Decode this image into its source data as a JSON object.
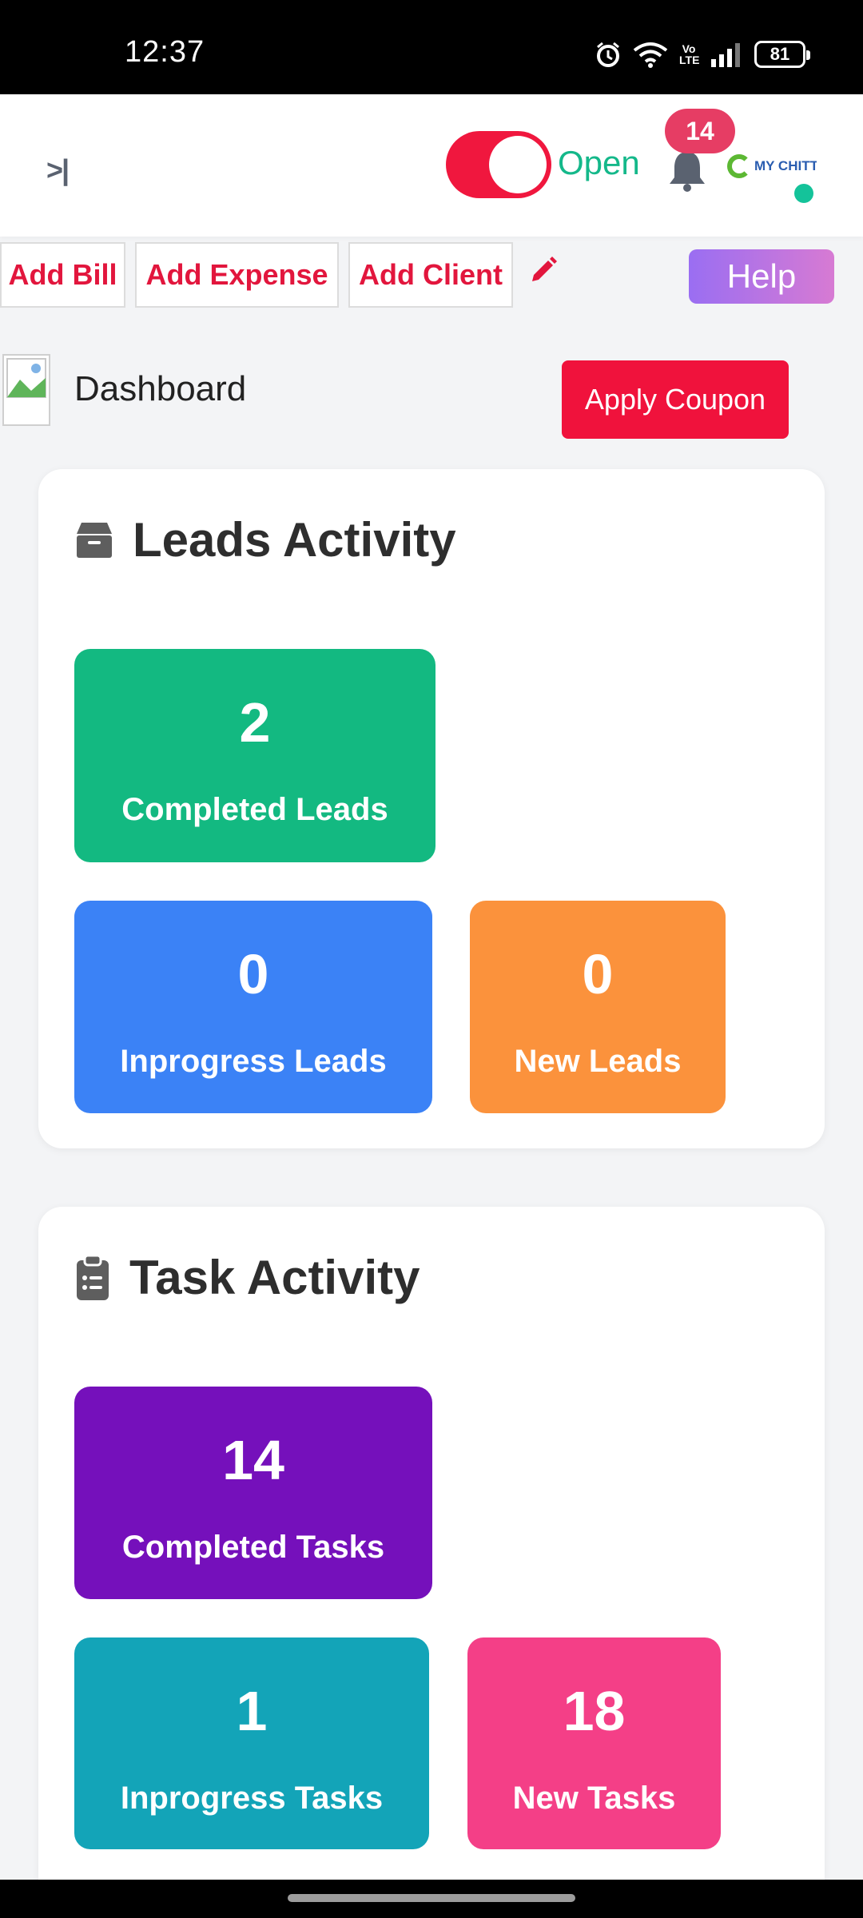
{
  "status_bar": {
    "time": "12:37",
    "battery": "81",
    "network_label": "Vo LTE"
  },
  "header": {
    "collapse_icon": ">|",
    "store_status": "Open",
    "notifications_count": "14",
    "logo_text": "MY CHITTI",
    "toggle_on_color": "#f0173e",
    "status_color": "#14b88a"
  },
  "quick_actions": {
    "add_bill": "Add Bill",
    "add_expense": "Add Expense",
    "add_client": "Add Client",
    "help": "Help"
  },
  "page": {
    "title": "Dashboard",
    "apply_coupon": "Apply Coupon"
  },
  "leads": {
    "title": "Leads Activity",
    "completed": {
      "value": "2",
      "label": "Completed Leads",
      "color": "#13b981"
    },
    "inprogress": {
      "value": "0",
      "label": "Inprogress Leads",
      "color": "#3b82f6"
    },
    "new": {
      "value": "0",
      "label": "New Leads",
      "color": "#fb923c"
    }
  },
  "tasks": {
    "title": "Task Activity",
    "completed": {
      "value": "14",
      "label": "Completed Tasks",
      "color": "#7510bb"
    },
    "inprogress": {
      "value": "1",
      "label": "Inprogress Tasks",
      "color": "#13a4b8"
    },
    "new": {
      "value": "18",
      "label": "New Tasks",
      "color": "#f43f87"
    }
  }
}
